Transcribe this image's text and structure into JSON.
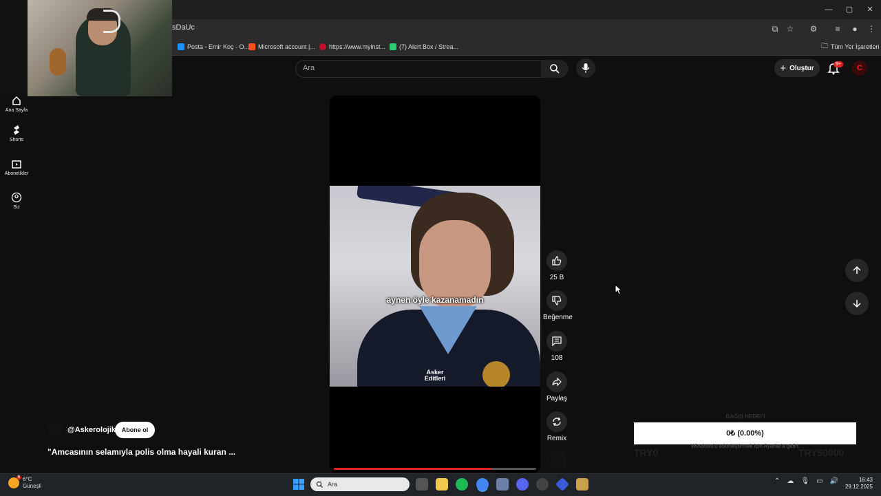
{
  "browser": {
    "url_fragment": "sDaUc",
    "bookmarks": [
      {
        "label": "Posta - Emir Koç - O...",
        "color": "#1e90ff"
      },
      {
        "label": "Microsoft account |...",
        "color": "#f25022"
      },
      {
        "label": "https://www.myinst...",
        "color": "#c0102a"
      },
      {
        "label": "(7) Alert Box / Strea...",
        "color": "#2ecc71"
      }
    ],
    "all_bookmarks_label": "Tüm Yer İşaretleri"
  },
  "youtube": {
    "search_placeholder": "Ara",
    "create_label": "Oluştur",
    "notif_badge": "9+",
    "sidebar": [
      {
        "label": "Ana Sayfa",
        "icon": "home-icon"
      },
      {
        "label": "Shorts",
        "icon": "shorts-icon"
      },
      {
        "label": "Abonelikler",
        "icon": "subscriptions-icon"
      },
      {
        "label": "Siz",
        "icon": "you-icon"
      }
    ],
    "video": {
      "subtitle": "aynen öyle kazanamadın",
      "watermark_line1": "Asker",
      "watermark_line2": "Editleri",
      "progress": 0.78
    },
    "actions": {
      "like_count": "25 B",
      "dislike_label": "Beğenme",
      "comment_count": "108",
      "share_label": "Paylaş",
      "remix_label": "Remix"
    },
    "channel": {
      "name": "@Askerolojik",
      "subscribe_label": "Abone ol",
      "video_title": "\"Amcasının selamıyla polis olma hayali kuran ..."
    }
  },
  "overlay_widget": {
    "title": "BAĞIŞ HEDEFİ",
    "bar_text": "0₺ (0.00%)",
    "min": "TRY0",
    "max": "TRY50000",
    "windows_notice": "Windows'u etkinleştirmek için Ayarlar'a gidin."
  },
  "taskbar": {
    "weather_temp": "6°C",
    "weather_desc": "Güneşli",
    "weather_badge": "6",
    "search_placeholder": "Ara",
    "time": "16:43",
    "date": "29.12.2025"
  }
}
